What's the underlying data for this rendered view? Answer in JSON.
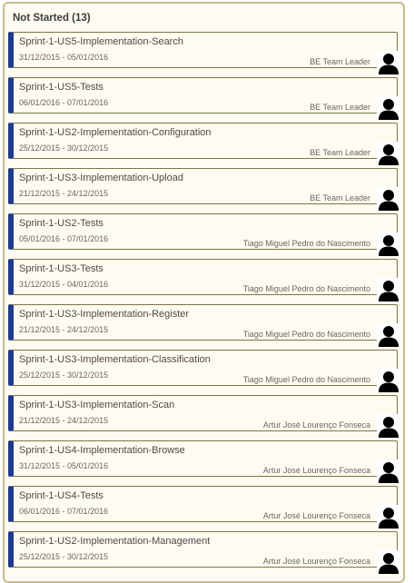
{
  "column": {
    "title": "Not Started (13)"
  },
  "tasks": [
    {
      "title": "Sprint-1-US5-Implementation-Search",
      "dates": "31/12/2015 - 05/01/2016",
      "assignee": "BE Team Leader"
    },
    {
      "title": "Sprint-1-US5-Tests",
      "dates": "06/01/2016 - 07/01/2016",
      "assignee": "BE Team Leader"
    },
    {
      "title": "Sprint-1-US2-Implementation-Configuration",
      "dates": "25/12/2015 - 30/12/2015",
      "assignee": "BE Team Leader"
    },
    {
      "title": "Sprint-1-US3-Implementation-Upload",
      "dates": "21/12/2015 - 24/12/2015",
      "assignee": "BE Team Leader"
    },
    {
      "title": "Sprint-1-US2-Tests",
      "dates": "05/01/2016 - 07/01/2016",
      "assignee": "Tiago Miguel Pedro do Nascimento"
    },
    {
      "title": "Sprint-1-US3-Tests",
      "dates": "31/12/2015 - 04/01/2016",
      "assignee": "Tiago Miguel Pedro do Nascimento"
    },
    {
      "title": "Sprint-1-US3-Implementation-Register",
      "dates": "21/12/2015 - 24/12/2015",
      "assignee": "Tiago Miguel Pedro do Nascimento"
    },
    {
      "title": "Sprint-1-US3-Implementation-Classification",
      "dates": "25/12/2015 - 30/12/2015",
      "assignee": "Tiago Miguel Pedro do Nascimento"
    },
    {
      "title": "Sprint-1-US3-Implementation-Scan",
      "dates": "21/12/2015 - 24/12/2015",
      "assignee": "Artur José Lourenço Fonseca"
    },
    {
      "title": "Sprint-1-US4-Implementation-Browse",
      "dates": "31/12/2015 - 05/01/2016",
      "assignee": "Artur José Lourenço Fonseca"
    },
    {
      "title": "Sprint-1-US4-Tests",
      "dates": "06/01/2016 - 07/01/2016",
      "assignee": "Artur José Lourenço Fonseca"
    },
    {
      "title": "Sprint-1-US2-Implementation-Management",
      "dates": "25/12/2015 - 30/12/2015",
      "assignee": "Artur José Lourenço Fonseca"
    }
  ],
  "style": {
    "card_accent": "#1e3a8a",
    "card_border": "#7f7446",
    "column_border": "#c9b98f",
    "avatar_icon": "user-silhouette-icon"
  }
}
